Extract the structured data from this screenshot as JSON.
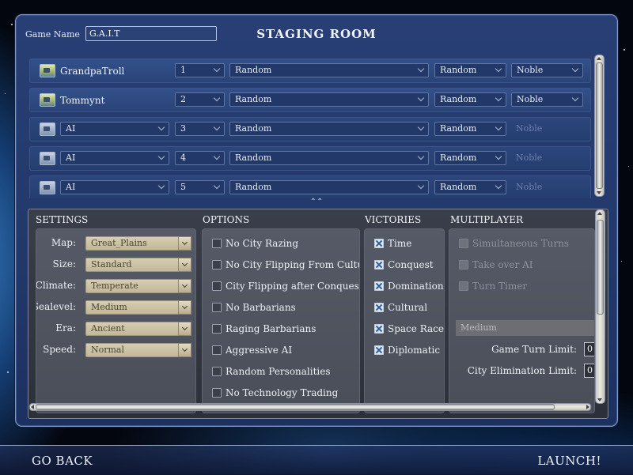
{
  "game_name": {
    "label": "Game Name",
    "value": "G.A.I.T"
  },
  "title": "STAGING ROOM",
  "players": [
    {
      "name": "GrandpaTroll",
      "type": "human",
      "slot": "1",
      "civ": "Random",
      "leader": "Random",
      "difficulty": "Noble"
    },
    {
      "name": "Tommynt",
      "type": "human",
      "slot": "2",
      "civ": "Random",
      "leader": "Random",
      "difficulty": "Noble"
    },
    {
      "name": "AI",
      "type": "ai",
      "slot": "3",
      "civ": "Random",
      "leader": "Random",
      "difficulty": "Noble"
    },
    {
      "name": "AI",
      "type": "ai",
      "slot": "4",
      "civ": "Random",
      "leader": "Random",
      "difficulty": "Noble"
    },
    {
      "name": "AI",
      "type": "ai",
      "slot": "5",
      "civ": "Random",
      "leader": "Random",
      "difficulty": "Noble"
    }
  ],
  "sections": {
    "settings": "SETTINGS",
    "options": "OPTIONS",
    "victories": "VICTORIES",
    "multiplayer": "MULTIPLAYER"
  },
  "settings": [
    {
      "label": "Map:",
      "value": "Great_Plains"
    },
    {
      "label": "Size:",
      "value": "Standard"
    },
    {
      "label": "Climate:",
      "value": "Temperate"
    },
    {
      "label": "Sealevel:",
      "value": "Medium"
    },
    {
      "label": "Era:",
      "value": "Ancient"
    },
    {
      "label": "Speed:",
      "value": "Normal"
    }
  ],
  "options": [
    {
      "label": "No City Razing",
      "checked": false
    },
    {
      "label": "No City Flipping From Culture",
      "checked": false
    },
    {
      "label": "City Flipping after Conquest",
      "checked": false
    },
    {
      "label": "No Barbarians",
      "checked": false
    },
    {
      "label": "Raging Barbarians",
      "checked": false
    },
    {
      "label": "Aggressive AI",
      "checked": false
    },
    {
      "label": "Random Personalities",
      "checked": false
    },
    {
      "label": "No Technology Trading",
      "checked": false
    }
  ],
  "victories": [
    {
      "label": "Time",
      "checked": true
    },
    {
      "label": "Conquest",
      "checked": true
    },
    {
      "label": "Domination",
      "checked": true
    },
    {
      "label": "Cultural",
      "checked": true
    },
    {
      "label": "Space Race",
      "checked": true
    },
    {
      "label": "Diplomatic",
      "checked": true
    }
  ],
  "multiplayer": {
    "options": [
      {
        "label": "Simultaneous Turns",
        "checked": false,
        "disabled": true
      },
      {
        "label": "Take over AI",
        "checked": false,
        "disabled": true
      },
      {
        "label": "Turn Timer",
        "checked": false,
        "disabled": true
      }
    ],
    "timer_speed": "Medium",
    "game_turn_limit": {
      "label": "Game Turn Limit:",
      "value": "0"
    },
    "city_elimination_limit": {
      "label": "City Elimination Limit:",
      "value": "0"
    }
  },
  "nav": {
    "back": "GO BACK",
    "launch": "LAUNCH!"
  },
  "colors": {
    "panel": "#22386a",
    "settings_bg": "#2c3039",
    "dropdown": "#c2b898"
  }
}
